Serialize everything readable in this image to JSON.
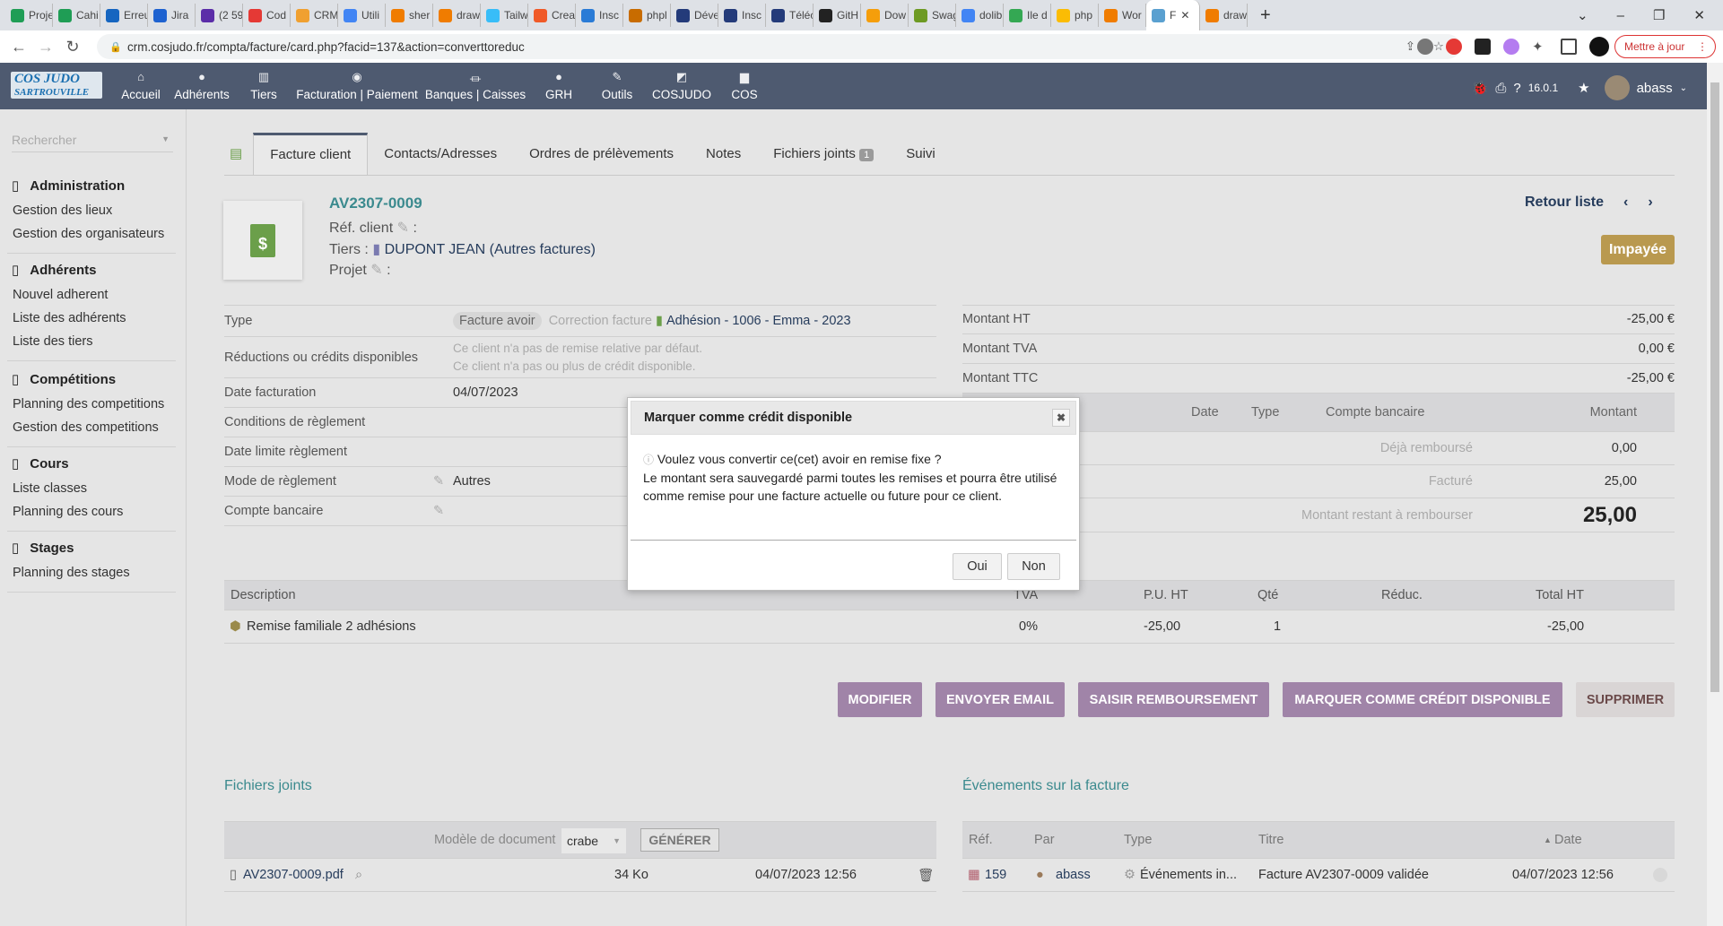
{
  "browser": {
    "tabs": [
      "Proje",
      "Cahi",
      "Erreu",
      "Jira",
      "(2 59",
      "Cod",
      "CRM",
      "Utili",
      "sher",
      "draw",
      "Tailw",
      "Crea",
      "Insc",
      "phpl",
      "Déve",
      "Insc",
      "Téléc",
      "GitH",
      "Dow",
      "Swag",
      "dolib",
      "Ile d",
      "php",
      "Wor",
      "F",
      "draw"
    ],
    "tab_colors": [
      "#1f9d55",
      "#1f9d55",
      "#1565c0",
      "#1e62d0",
      "#5b2da8",
      "#e53935",
      "#f0a030",
      "#4285f4",
      "#f07c00",
      "#f07c00",
      "#38bdf8",
      "#f05a28",
      "#2a7bd6",
      "#c86c00",
      "#243b7a",
      "#243b7a",
      "#243b7a",
      "#222222",
      "#f59e0b",
      "#6d9a23",
      "#4285f4",
      "#34a853",
      "#fbbc04",
      "#f07c00",
      "#5aa0d0",
      "#f07c00"
    ],
    "url": "crm.cosjudo.fr/compta/facture/card.php?facid=137&action=converttoreduc",
    "update_label": "Mettre à jour"
  },
  "topnav": {
    "logo": "COS JUDO SARTROUVILLE",
    "items": [
      {
        "label": "Accueil",
        "icon": "home-icon"
      },
      {
        "label": "Adhérents",
        "icon": "user-icon"
      },
      {
        "label": "Tiers",
        "icon": "building-icon"
      },
      {
        "label": "Facturation | Paiement",
        "icon": "coins-icon"
      },
      {
        "label": "Banques | Caisses",
        "icon": "bank-icon"
      },
      {
        "label": "GRH",
        "icon": "user-tie-icon"
      },
      {
        "label": "Outils",
        "icon": "wrench-icon"
      },
      {
        "label": "COSJUDO",
        "icon": "external-icon"
      },
      {
        "label": "COS",
        "icon": "note-icon"
      }
    ],
    "version": "16.0.1",
    "user": "abass"
  },
  "sidebar": {
    "search_placeholder": "Rechercher",
    "groups": [
      {
        "title": "Administration",
        "items": [
          "Gestion des lieux",
          "Gestion des organisateurs"
        ]
      },
      {
        "title": "Adhérents",
        "items": [
          "Nouvel adherent",
          "Liste des adhérents",
          "Liste des tiers"
        ]
      },
      {
        "title": "Compétitions",
        "items": [
          "Planning des competitions",
          "Gestion des competitions"
        ]
      },
      {
        "title": "Cours",
        "items": [
          "Liste classes",
          "Planning des cours"
        ]
      },
      {
        "title": "Stages",
        "items": [
          "Planning des stages"
        ]
      }
    ]
  },
  "tabs": [
    {
      "label": "Facture client"
    },
    {
      "label": "Contacts/Adresses"
    },
    {
      "label": "Ordres de prélèvements"
    },
    {
      "label": "Notes"
    },
    {
      "label": "Fichiers joints",
      "badge": "1"
    },
    {
      "label": "Suivi"
    }
  ],
  "card": {
    "ref": "AV2307-0009",
    "ref_client_label": "Réf. client",
    "tiers_label": "Tiers :",
    "tiers": "DUPONT JEAN (Autres factures)",
    "projet_label": "Projet",
    "back": "Retour liste",
    "status": "Impayée",
    "status_color": "#b9994f"
  },
  "fields": {
    "type_label": "Type",
    "type_value": "Facture avoir",
    "correction_label": "Correction facture",
    "correction_ref": "Adhésion - 1006 - Emma - 2023",
    "reductions_label": "Réductions ou crédits disponibles",
    "reduc1": "Ce client n'a pas de remise relative par défaut.",
    "reduc2": "Ce client n'a pas ou plus de crédit disponible.",
    "date_label": "Date facturation",
    "date": "04/07/2023",
    "cond_label": "Conditions de règlement",
    "limit_label": "Date limite règlement",
    "mode_label": "Mode de règlement",
    "mode": "Autres",
    "bank_label": "Compte bancaire"
  },
  "amounts": {
    "ht_label": "Montant HT",
    "ht": "-25,00 €",
    "tva_label": "Montant TVA",
    "tva": "0,00 €",
    "ttc_label": "Montant TTC",
    "ttc": "-25,00 €",
    "pay_headers": [
      "Date",
      "Type",
      "Compte bancaire",
      "Montant"
    ],
    "deja_label": "Déjà remboursé",
    "deja": "0,00",
    "facture_label": "Facturé",
    "facture": "25,00",
    "reste_label": "Montant restant à rembourser",
    "reste": "25,00"
  },
  "lines": {
    "headers": [
      "Description",
      "TVA",
      "P.U. HT",
      "Qté",
      "Réduc.",
      "Total HT"
    ],
    "rows": [
      {
        "desc": "Remise familiale 2 adhésions",
        "tva": "0%",
        "pu": "-25,00",
        "qty": "1",
        "reduc": "",
        "total": "-25,00"
      }
    ]
  },
  "actions": [
    "MODIFIER",
    "ENVOYER EMAIL",
    "SAISIR REMBOURSEMENT",
    "MARQUER COMME CRÉDIT DISPONIBLE",
    "SUPPRIMER"
  ],
  "files": {
    "title": "Fichiers joints",
    "model_label": "Modèle de document",
    "model": "crabe",
    "generate": "GÉNÉRER",
    "name": "AV2307-0009.pdf",
    "size": "34 Ko",
    "date": "04/07/2023 12:56"
  },
  "events": {
    "title": "Événements sur la facture",
    "headers": [
      "Réf.",
      "Par",
      "Type",
      "Titre",
      "Date"
    ],
    "row": {
      "ref": "159",
      "by": "abass",
      "type": "Événements in...",
      "title": "Facture AV2307-0009 validée",
      "date": "04/07/2023 12:56"
    }
  },
  "modal": {
    "title": "Marquer comme crédit disponible",
    "question": "Voulez vous convertir ce(cet) avoir en remise fixe ?",
    "text": "Le montant sera sauvegardé parmi toutes les remises et pourra être utilisé comme remise pour une facture actuelle ou future pour ce client.",
    "yes": "Oui",
    "no": "Non"
  }
}
